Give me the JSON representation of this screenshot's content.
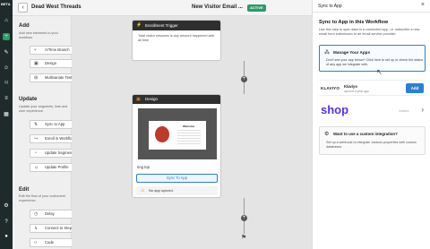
{
  "rail": {
    "beta": "BETA"
  },
  "header": {
    "app_title": "Dead West Threads",
    "flow_title": "New Visitor Email ...",
    "status_badge": "ACTIVE"
  },
  "palette": {
    "add": {
      "title": "Add",
      "subtitle": "Add new elements to your workflow.",
      "items": [
        "A/Time Branch",
        "Design",
        "Multivariate Test"
      ]
    },
    "update": {
      "title": "Update",
      "subtitle": "Update your segments, lists and user experience.",
      "items": [
        "Sync to App",
        "Enroll in Workflow",
        "Update Segment",
        "Update Profile"
      ]
    },
    "edit": {
      "title": "Edit",
      "subtitle": "Edit the flow of your customers' experience.",
      "items": [
        "Delay",
        "Connect to Step",
        "Code"
      ]
    }
  },
  "canvas": {
    "trigger": {
      "title": "Enrollment Trigger",
      "body": "Total visitor sessions is any amount happened with all time"
    },
    "design": {
      "title": "Design",
      "preview_text": "Welcome",
      "name": "ring top",
      "sync_label": "Sync To App",
      "warning": "No app synced."
    }
  },
  "panel": {
    "top_title": "Sync to App",
    "heading": "Sync to App in this Workflow",
    "description": "Use this step to sync data to a connected app, i.e. subscribe a new email form submission to an email service provider.",
    "manage": {
      "title": "Manage Your Apps",
      "text": "Don't see your app below? Click here to set up or check the status of any app we integrate with."
    },
    "klaviyo": {
      "logo": "KLAVIYO",
      "name": "Klaviyo",
      "date": "synced a year ago",
      "add_label": "Add"
    },
    "shop": {
      "logo": "shop",
      "status": "Inactive"
    },
    "custom": {
      "title": "Want to use a custom integration?",
      "text": "Set up a webhook to integrate Justuno properties with custom databases."
    }
  },
  "icons": {
    "close": "close-icon",
    "back": "back-arrow-icon"
  }
}
